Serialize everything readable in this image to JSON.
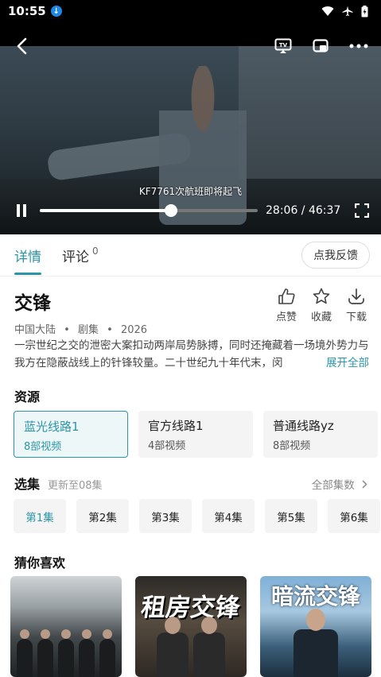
{
  "status_bar": {
    "time": "10:55"
  },
  "player": {
    "subtitle": "KF7761次航班即将起飞",
    "current_time": "28:06",
    "duration": "46:37",
    "time_separator": " / ",
    "progress_fraction": 0.603
  },
  "tabs": [
    {
      "label": "详情"
    },
    {
      "label": "评论",
      "count": "0"
    }
  ],
  "feedback_label": "点我反馈",
  "show": {
    "title": "交锋",
    "region": "中国大陆",
    "category": "剧集",
    "year": "2026",
    "dot": "•",
    "description": "一宗世纪之交的泄密大案扣动两岸局势脉搏，同时还掩藏着一场境外势力与我方在隐蔽战线上的针锋较量。二十世纪九十年代末，闵",
    "expand_label": "展开全部"
  },
  "actions": [
    {
      "label": "点赞",
      "icon": "thumbs-up-icon"
    },
    {
      "label": "收藏",
      "icon": "star-icon"
    },
    {
      "label": "下载",
      "icon": "download-icon"
    }
  ],
  "sources_title": "资源",
  "sources": [
    {
      "name": "蓝光线路1",
      "count": "8部视频"
    },
    {
      "name": "官方线路1",
      "count": "4部视频"
    },
    {
      "name": "普通线路yz",
      "count": "8部视频"
    }
  ],
  "episodes_header": {
    "title": "选集",
    "update": "更新至08集",
    "all": "全部集数"
  },
  "episodes": [
    "第1集",
    "第2集",
    "第3集",
    "第4集",
    "第5集",
    "第6集"
  ],
  "recs_title": "猜你喜欢",
  "recs": [
    {
      "poster_title": ""
    },
    {
      "poster_title": "租房交锋"
    },
    {
      "poster_title": "暗流交锋"
    }
  ],
  "colors": {
    "accent": "#2b95a8"
  }
}
